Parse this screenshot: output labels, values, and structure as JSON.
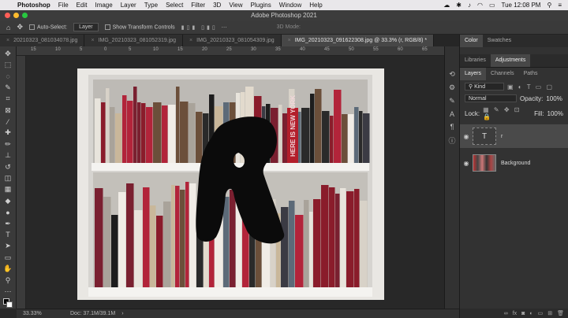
{
  "menubar": {
    "app_name": "Photoshop",
    "items": [
      "File",
      "Edit",
      "Image",
      "Layer",
      "Type",
      "Select",
      "Filter",
      "3D",
      "View",
      "Plugins",
      "Window",
      "Help"
    ],
    "clock": "Tue 12:08 PM"
  },
  "window": {
    "title": "Adobe Photoshop 2021"
  },
  "options": {
    "auto_select_label": "Auto-Select:",
    "auto_select_value": "Layer",
    "transform_controls_label": "Show Transform Controls",
    "mode_3d": "3D Mode:"
  },
  "tabs": [
    {
      "label": "20210323_081034078.jpg",
      "active": false
    },
    {
      "label": "IMG_20210323_081052319.jpg",
      "active": false
    },
    {
      "label": "IMG_20210323_081054309.jpg",
      "active": false
    },
    {
      "label": "IMG_20210323_091622308.jpg @ 33.3% (r, RGB/8) *",
      "active": true
    }
  ],
  "rulers": {
    "h_ticks": [
      "15",
      "10",
      "5",
      "0",
      "5",
      "10",
      "15",
      "20",
      "25",
      "30",
      "35",
      "40",
      "45",
      "50",
      "55",
      "60",
      "65",
      "70"
    ]
  },
  "status": {
    "zoom": "33.33%",
    "doc": "Doc: 37.1M/39.1M"
  },
  "panels": {
    "top_tabs": [
      "Color",
      "Swatches"
    ],
    "mid_tabs": [
      "Libraries",
      "Adjustments"
    ],
    "layer_tabs": [
      "Layers",
      "Channels",
      "Paths"
    ],
    "kind": "Kind",
    "blend_mode": "Normal",
    "opacity_label": "Opacity:",
    "opacity_value": "100%",
    "lock_label": "Lock:",
    "fill_label": "Fill:",
    "fill_value": "100%",
    "layers": [
      {
        "name": "r",
        "type": "text",
        "selected": true
      },
      {
        "name": "Background",
        "type": "image",
        "selected": false
      }
    ]
  },
  "photo": {
    "spine_text_1": "HERE IS NEW YORK",
    "overlay_letter": "R"
  },
  "colors": {
    "accent": "#e9e7ea",
    "background": "#282828"
  }
}
